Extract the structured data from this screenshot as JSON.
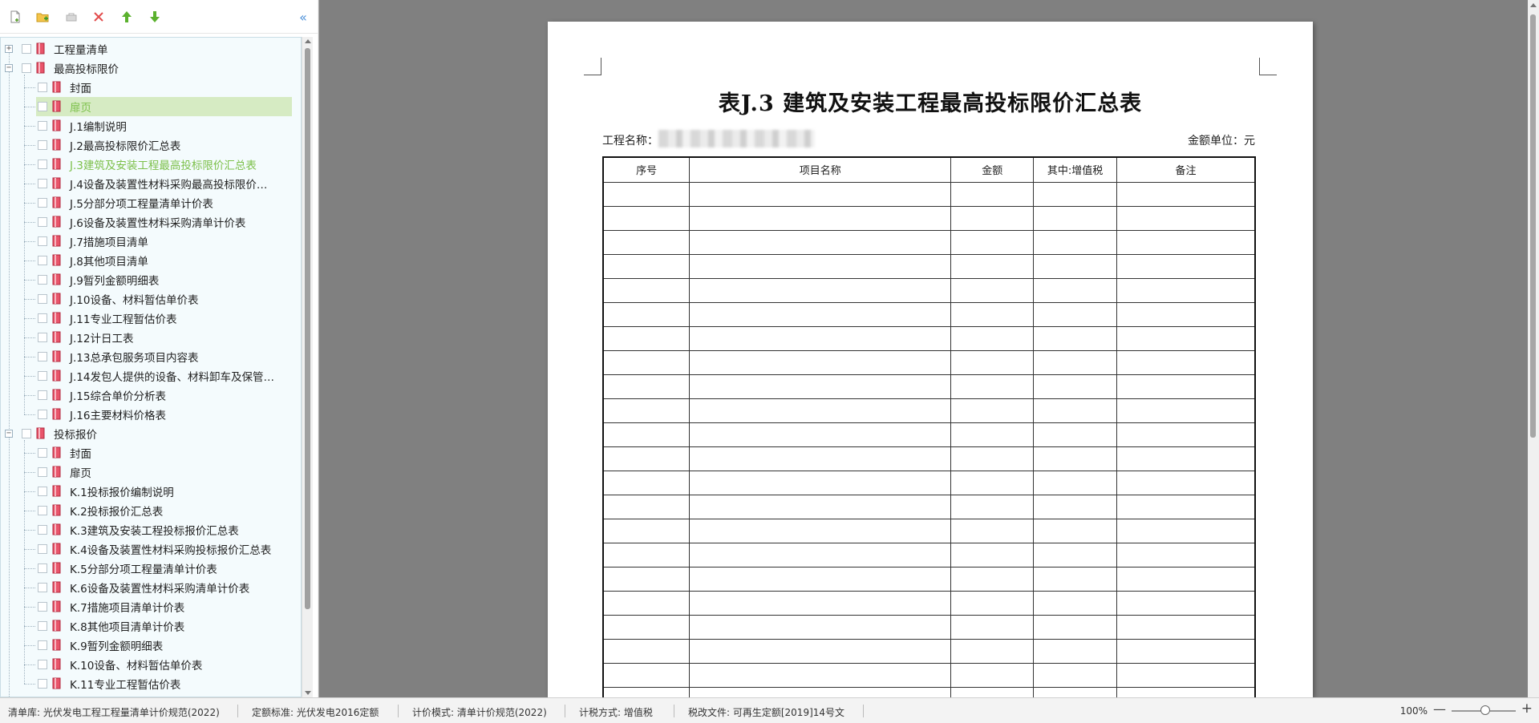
{
  "toolbar": {
    "icons": [
      "new-file-icon",
      "add-folder-icon",
      "link-icon",
      "delete-icon",
      "move-up-icon",
      "move-down-icon"
    ],
    "collapse": "«"
  },
  "tree": {
    "groups": [
      {
        "label": "工程量清单",
        "expander": "+",
        "children": []
      },
      {
        "label": "最高投标限价",
        "expander": "−",
        "children": [
          {
            "label": "封面"
          },
          {
            "label": "扉页",
            "selected": true
          },
          {
            "label": "J.1编制说明"
          },
          {
            "label": "J.2最高投标限价汇总表"
          },
          {
            "label": "J.3建筑及安装工程最高投标限价汇总表",
            "active": true
          },
          {
            "label": "J.4设备及装置性材料采购最高投标限价…"
          },
          {
            "label": "J.5分部分项工程量清单计价表"
          },
          {
            "label": "J.6设备及装置性材料采购清单计价表"
          },
          {
            "label": "J.7措施项目清单"
          },
          {
            "label": "J.8其他项目清单"
          },
          {
            "label": "J.9暂列金额明细表"
          },
          {
            "label": "J.10设备、材料暂估单价表"
          },
          {
            "label": "J.11专业工程暂估价表"
          },
          {
            "label": "J.12计日工表"
          },
          {
            "label": "J.13总承包服务项目内容表"
          },
          {
            "label": "J.14发包人提供的设备、材料卸车及保管…"
          },
          {
            "label": "J.15综合单价分析表"
          },
          {
            "label": "J.16主要材料价格表"
          }
        ]
      },
      {
        "label": "投标报价",
        "expander": "−",
        "children": [
          {
            "label": "封面"
          },
          {
            "label": "扉页"
          },
          {
            "label": "K.1投标报价编制说明"
          },
          {
            "label": "K.2投标报价汇总表"
          },
          {
            "label": "K.3建筑及安装工程投标报价汇总表"
          },
          {
            "label": "K.4设备及装置性材料采购投标报价汇总表"
          },
          {
            "label": "K.5分部分项工程量清单计价表"
          },
          {
            "label": "K.6设备及装置性材料采购清单计价表"
          },
          {
            "label": "K.7措施项目清单计价表"
          },
          {
            "label": "K.8其他项目清单计价表"
          },
          {
            "label": "K.9暂列金额明细表"
          },
          {
            "label": "K.10设备、材料暂估单价表"
          },
          {
            "label": "K.11专业工程暂估价表"
          }
        ]
      }
    ]
  },
  "report": {
    "title": "表J.3 建筑及安装工程最高投标限价汇总表",
    "project_label": "工程名称：",
    "unit_label": "金额单位：元",
    "columns": [
      "序号",
      "项目名称",
      "金额",
      "其中:增值税",
      "备注"
    ],
    "empty_rows": 22
  },
  "statusbar": {
    "items": [
      "清单库: 光伏发电工程工程量清单计价规范(2022)",
      "定额标准: 光伏发电2016定额",
      "计价模式: 清单计价规范(2022)",
      "计税方式: 增值税",
      "税改文件: 可再生定额[2019]14号文"
    ],
    "zoom": "100%",
    "zoom_minus": "—",
    "zoom_plus": "+"
  },
  "colors": {
    "selected_row_bg": "#d6ebc3",
    "active_text": "#7cc04a",
    "tree_bg": "#f4fbfd",
    "preview_bg": "#808080"
  }
}
